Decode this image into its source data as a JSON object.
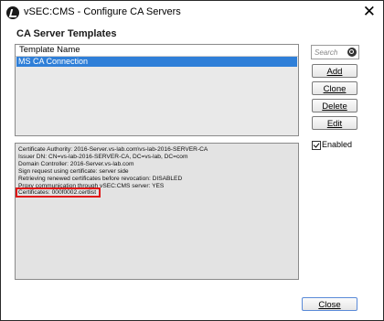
{
  "window": {
    "title": "vSEC:CMS - Configure CA Servers",
    "close_glyph": "✕"
  },
  "section": {
    "title": "CA Server Templates"
  },
  "template_list": {
    "column_header": "Template Name",
    "rows": [
      {
        "name": "MS CA Connection",
        "selected": true
      }
    ]
  },
  "details": {
    "lines": [
      "Certificate Authority: 2016-Server.vs-lab.com\\vs-lab-2016-SERVER-CA",
      "Issuer DN: CN=vs-lab-2016-SERVER-CA, DC=vs-lab, DC=com",
      "Domain Controller: 2016-Server.vs-lab.com",
      "Sign request using certificate: server side",
      "Retrieving renewed certificates before revocation: DISABLED",
      "Proxy communication through vSEC:CMS server: YES",
      "Certificates: 000f0002.certlist"
    ],
    "highlighted_line_index": 6,
    "highlight_color": "#e01818"
  },
  "search": {
    "placeholder": "Search",
    "icon": "search-icon"
  },
  "buttons": {
    "add": "Add",
    "clone": "Clone",
    "delete": "Delete",
    "edit": "Edit",
    "close": "Close"
  },
  "enabled_checkbox": {
    "label": "Enabled",
    "checked": true
  },
  "colors": {
    "selection": "#2f7fd8",
    "panel_bg": "#e3e3e3",
    "highlight_border": "#e01818"
  }
}
